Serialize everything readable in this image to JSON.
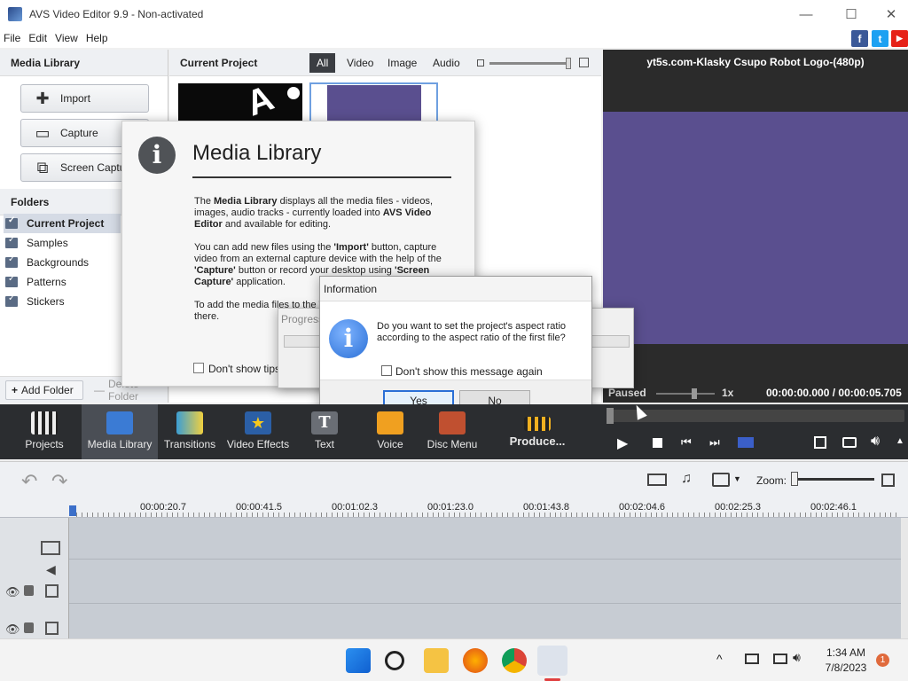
{
  "window": {
    "title": "AVS Video Editor 9.9 - Non-activated",
    "minimize": "—",
    "maximize": "☐",
    "close": "✕"
  },
  "menu": [
    "File",
    "Edit",
    "View",
    "Help"
  ],
  "social": {
    "facebook": "f",
    "twitter": "t",
    "youtube": "▶"
  },
  "left_panel": {
    "title": "Media Library",
    "buttons": [
      "Import",
      "Capture",
      "Screen Capture"
    ],
    "folders_title": "Folders",
    "folders": [
      "Current Project",
      "Samples",
      "Backgrounds",
      "Patterns",
      "Stickers"
    ],
    "add_folder": "Add Folder",
    "delete_folder": "Delete Folder"
  },
  "center": {
    "title": "Current Project",
    "tabs": [
      "All",
      "Video",
      "Image",
      "Audio"
    ],
    "active_tab": "All",
    "thumb_watermark": "A"
  },
  "preview": {
    "title": "yt5s.com-Klasky Csupo Robot Logo-(480p)",
    "status": "Paused",
    "speed": "1x",
    "time": "00:00:00.000 / 00:00:05.705"
  },
  "tip": {
    "title": "Media Library",
    "para1_pre": "The ",
    "para1_b1": "Media Library",
    "para1_mid": " displays all the media files - videos, images, audio tracks - currently loaded into ",
    "para1_b2": "AVS Video Editor",
    "para1_post": " and available for editing.",
    "para2_pre": "You can add new files using the ",
    "para2_b1": "'Import'",
    "para2_mid1": " button, capture video from an external capture device with the help of the ",
    "para2_b2": "'Capture'",
    "para2_mid2": " button or record your desktop using ",
    "para2_b3": "'Screen Capture'",
    "para2_post": " application.",
    "para3": "To add the media files to the Timeline, drag and drop them there.",
    "dont_show": "Don't show tips"
  },
  "progress": {
    "title": "Progress"
  },
  "info_dialog": {
    "title": "Information",
    "message": "Do you want to set the project's aspect ratio according to the aspect ratio of the first file?",
    "checkbox": "Don't show this message again",
    "yes": "Yes",
    "no": "No"
  },
  "toolbar": [
    "Projects",
    "Media Library",
    "Transitions",
    "Video Effects",
    "Text",
    "Voice",
    "Disc Menu",
    "Produce..."
  ],
  "timeline": {
    "zoom_label": "Zoom:",
    "ruler": [
      "00:00:20.7",
      "00:00:41.5",
      "00:01:02.3",
      "00:01:23.0",
      "00:01:43.8",
      "00:02:04.6",
      "00:02:25.3",
      "00:02:46.1"
    ]
  },
  "taskbar": {
    "time": "1:34 AM",
    "date": "7/8/2023",
    "notification_count": "1"
  },
  "colors": {
    "accent": "#3b6fc9",
    "toolbar_bg": "#2b2d30",
    "preview_purple": "#5a4f8f"
  }
}
